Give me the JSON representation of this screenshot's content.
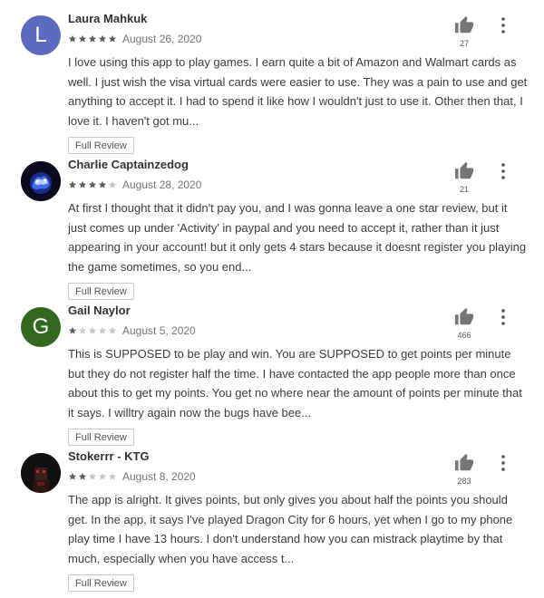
{
  "colors": {
    "star_filled": "#5f5f5f",
    "star_empty": "#c8c8c8",
    "thumb_icon": "#757575",
    "avatar_laura": "#5c6bc0",
    "avatar_gail": "#33691e"
  },
  "reviews": [
    {
      "author": "Laura Mahkuk",
      "avatar_letter": "L",
      "avatar_type": "letter",
      "rating": 5,
      "date": "August 26, 2020",
      "text": "I love using this app to play games. I earn quite a bit of Amazon and Walmart cards as well. I just wish the visa virtual cards were easier to use. They was a pain to use and get anything to accept it. I had to spend it like how I wouldn't just to use it. Other then that, I love it. I haven't got mu...",
      "full_review_label": "Full Review",
      "helpful_count": "27"
    },
    {
      "author": "Charlie Captainzedog",
      "avatar_letter": "",
      "avatar_type": "image",
      "rating": 4,
      "date": "August 28, 2020",
      "text": "At first I thought that it didn't pay you, and I was gonna leave a one star review, but it just comes up under 'Activity' in paypal and you need to accept it, rather than it just appearing in your account! but it only gets 4 stars because it doesnt register you playing the game sometimes, so you end...",
      "full_review_label": "Full Review",
      "helpful_count": "21"
    },
    {
      "author": "Gail Naylor",
      "avatar_letter": "G",
      "avatar_type": "letter",
      "rating": 1,
      "date": "August 5, 2020",
      "text": "This is SUPPOSED to be play and win. You are SUPPOSED to get points per minute but they do not register half the time. I have contacted the app people more than once about this to get my points. You get no where near the amount of points per minute that it says. I willtry again now the bugs have bee...",
      "full_review_label": "Full Review",
      "helpful_count": "466"
    },
    {
      "author": "Stokerrr - KTG",
      "avatar_letter": "",
      "avatar_type": "image",
      "rating": 2,
      "date": "August 8, 2020",
      "text": "The app is alright. It gives points, but only gives you about half the points you should get. In the app, it says I've played Dragon City for 6 hours, yet when I go to my phone play time I have 13 hours. I don't understand how you can mistrack playtime by that much, especially when you have access t...",
      "full_review_label": "Full Review",
      "helpful_count": "283"
    }
  ]
}
